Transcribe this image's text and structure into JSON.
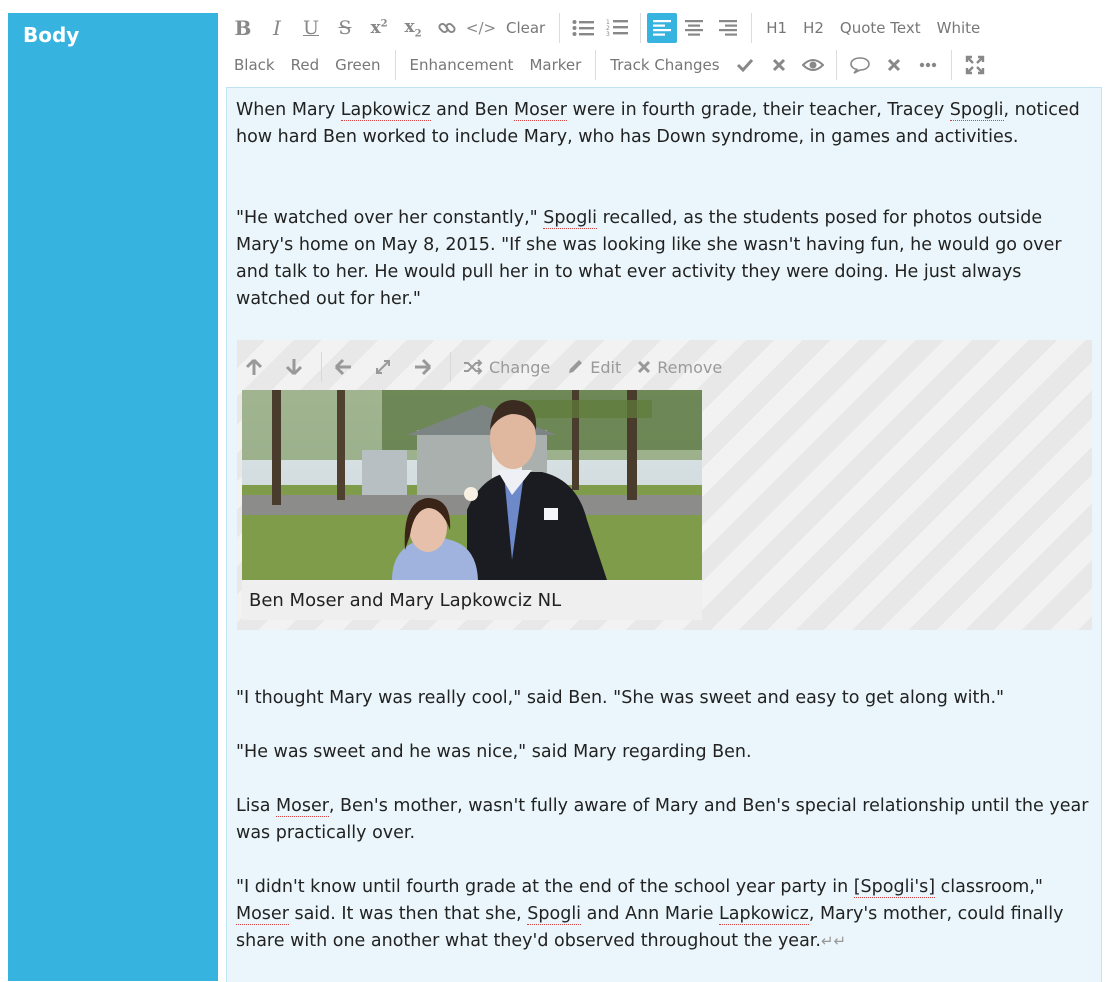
{
  "sidebar": {
    "label": "Body"
  },
  "toolbar": {
    "row1": {
      "clear": "Clear",
      "h1": "H1",
      "h2": "H2",
      "quote": "Quote Text",
      "white": "White"
    },
    "row2": {
      "black": "Black",
      "red": "Red",
      "green": "Green",
      "enhancement": "Enhancement",
      "marker": "Marker",
      "track_changes": "Track Changes"
    }
  },
  "content": {
    "p1": [
      "When Mary ",
      "Lapkowicz",
      " and Ben ",
      "Moser",
      " were in fourth grade, their teacher, Tracey ",
      "Spogli",
      ", noticed how hard Ben worked to include Mary, who has Down syndrome, in games and activities."
    ],
    "p2": [
      "\"He watched over her constantly,\" ",
      "Spogli",
      " recalled, as the students posed for photos outside Mary's home on May 8, 2015. \"If she was looking like she wasn't having fun, he would go over and talk to her. He would pull her in to what ever activity they were doing. He just always watched out for her.\""
    ],
    "image_tools": {
      "change": "Change",
      "edit": "Edit",
      "remove": "Remove"
    },
    "caption": "Ben Moser and Mary Lapkowciz NL",
    "p3": "\"I thought Mary was really cool,\" said Ben. \"She was sweet and easy to get along with.\"",
    "p4": "\"He was sweet and he was nice,\" said Mary regarding Ben.",
    "p5": [
      "Lisa ",
      "Moser",
      ", Ben's mother, wasn't fully aware of Mary and Ben's special relationship until the year was practically over."
    ],
    "p6": [
      "\"I didn't know until fourth grade at the end of the school year party in ",
      "[Spogli's]",
      " classroom,\" ",
      "Moser",
      " said. It was then that she, ",
      "Spogli",
      " and Ann Marie ",
      "Lapkowicz",
      ", Mary's mother, could finally share with one another what they'd observed throughout the year."
    ],
    "end_marks": "↵↵"
  },
  "colors": {
    "accent": "#37b3e0",
    "editor_bg": "#eaf6fb",
    "tracked_underline": "#d94040"
  }
}
